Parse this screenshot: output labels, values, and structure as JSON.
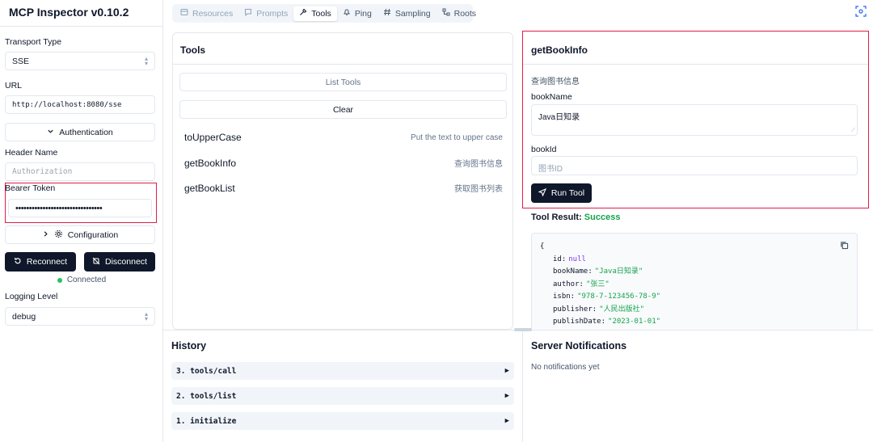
{
  "app": {
    "title": "MCP Inspector v0.10.2"
  },
  "sidebar": {
    "transport_label": "Transport Type",
    "transport_value": "SSE",
    "url_label": "URL",
    "url_value": "http://localhost:8080/sse",
    "auth_button": "Authentication",
    "header_name_label": "Header Name",
    "header_name_placeholder": "Authorization",
    "bearer_label": "Bearer Token",
    "bearer_value": "••••••••••••••••••••••••••••••••",
    "config_button": "Configuration",
    "reconnect_button": "Reconnect",
    "disconnect_button": "Disconnect",
    "status": "Connected",
    "logging_label": "Logging Level",
    "logging_value": "debug"
  },
  "tabs": [
    {
      "label": "Resources",
      "icon": "resources-icon"
    },
    {
      "label": "Prompts",
      "icon": "prompts-icon"
    },
    {
      "label": "Tools",
      "icon": "tools-icon"
    },
    {
      "label": "Ping",
      "icon": "ping-icon"
    },
    {
      "label": "Sampling",
      "icon": "sampling-icon"
    },
    {
      "label": "Roots",
      "icon": "roots-icon"
    }
  ],
  "tools": {
    "title": "Tools",
    "list_button": "List Tools",
    "clear_button": "Clear",
    "items": [
      {
        "name": "toUpperCase",
        "desc": "Put the text to upper case"
      },
      {
        "name": "getBookInfo",
        "desc": "查询图书信息"
      },
      {
        "name": "getBookList",
        "desc": "获取图书列表"
      }
    ]
  },
  "detail": {
    "title": "getBookInfo",
    "desc": "查询图书信息",
    "bookname_label": "bookName",
    "bookname_value": "Java日知录",
    "bookid_label": "bookId",
    "bookid_placeholder": "图书ID",
    "run_button": "Run Tool",
    "result_label": "Tool Result:",
    "result_status": "Success",
    "result_lines": [
      {
        "key": "id:",
        "value": "null",
        "kind": "null"
      },
      {
        "key": "bookName:",
        "value": "\"Java日知录\"",
        "kind": "str"
      },
      {
        "key": "author:",
        "value": "\"张三\"",
        "kind": "str"
      },
      {
        "key": "isbn:",
        "value": "\"978-7-123456-78-9\"",
        "kind": "str"
      },
      {
        "key": "publisher:",
        "value": "\"人民出版社\"",
        "kind": "str"
      },
      {
        "key": "publishDate:",
        "value": "\"2023-01-01\"",
        "kind": "str"
      }
    ],
    "open_brace": "{"
  },
  "history": {
    "title": "History",
    "items": [
      "3. tools/call",
      "2. tools/list",
      "1. initialize"
    ]
  },
  "notifications": {
    "title": "Server Notifications",
    "empty": "No notifications yet"
  },
  "colors": {
    "success": "#16a34a",
    "highlight": "#e11d48",
    "dark": "#0f172a",
    "connected": "#22c55e"
  }
}
